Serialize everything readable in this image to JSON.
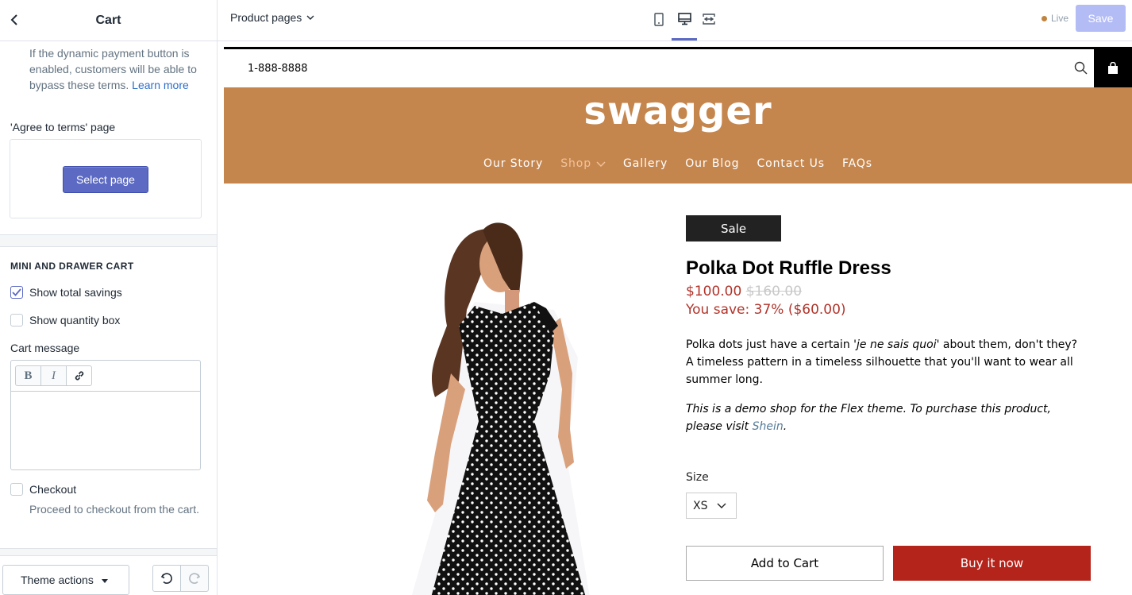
{
  "sidebar": {
    "title": "Cart",
    "back_icon": "chevron-left-icon",
    "help_text": "If the dynamic payment button is enabled, customers will be able to bypass these terms.",
    "help_link": "Learn more",
    "terms_label": "'Agree to terms' page",
    "select_page_label": "Select page",
    "section_heading": "MINI AND DRAWER CART",
    "show_total_savings": {
      "label": "Show total savings",
      "checked": true
    },
    "show_quantity_box": {
      "label": "Show quantity box",
      "checked": false
    },
    "cart_message_label": "Cart message",
    "rte_buttons": [
      "B",
      "I"
    ],
    "checkout": {
      "label": "Checkout",
      "checked": false
    },
    "checkout_help": "Proceed to checkout from the cart.",
    "theme_actions_label": "Theme actions"
  },
  "topbar": {
    "page_select": "Product pages",
    "live_label": "Live",
    "save_label": "Save"
  },
  "preview": {
    "phone": "1-888-8888",
    "logo": "swagger",
    "nav": [
      "Our Story",
      "Shop",
      "Gallery",
      "Our Blog",
      "Contact Us",
      "FAQs"
    ],
    "active_nav": "Shop",
    "badge": "Sale",
    "product_title": "Polka Dot Ruffle Dress",
    "price": "$100.00",
    "compare_price": "$160.00",
    "savings": "You save: 37% ($60.00)",
    "description_pre": "Polka dots just have a certain '",
    "description_em": "je ne sais quoi",
    "description_post": "' about them, don't they? A timeless pattern in a timeless silhouette that you'll want to wear all summer long.",
    "demo_note_pre": "This is a demo shop for the Flex theme. To purchase this product, please visit ",
    "demo_note_link": "Shein",
    "demo_note_post": ".",
    "size_label": "Size",
    "size_value": "XS",
    "add_to_cart": "Add to Cart",
    "buy_now": "Buy it now"
  },
  "colors": {
    "accent": "#5c6ac4",
    "header_bg": "#c5864e",
    "sale_red": "#b1342a",
    "buy_now_bg": "#b5241b"
  }
}
